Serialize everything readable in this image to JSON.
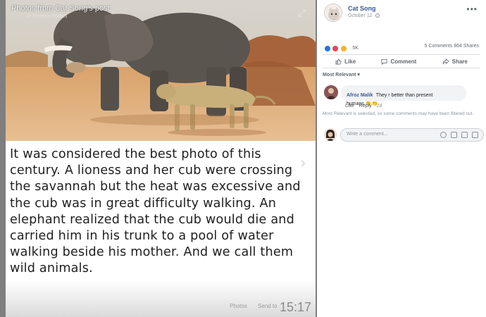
{
  "photo": {
    "caption": "Photos from Cat Song's post",
    "subcaption": "in Timeline Photos",
    "expand_icon": "expand-icon"
  },
  "story": {
    "text": "It was considered the best photo of this century. A lioness and her cub were crossing the savannah but the heat was excessive and the cub was in great difficulty walking. An elephant realized that the cub would die and carried him in his trunk to a pool of water walking beside his mother. And we call them wild animals.",
    "next_icon": "chevron-right-icon"
  },
  "phone_bar": {
    "meta_a": "Photos",
    "meta_b": "Send to",
    "time": "15:17"
  },
  "post": {
    "author": "Cat Song",
    "date": "October 12",
    "reaction_count": "5K",
    "comments": "5 Comments",
    "shares": "864 Shares",
    "actions": {
      "like": "Like",
      "comment": "Comment",
      "share": "Share"
    },
    "sort_label": "Most Relevant ▾",
    "colors": {
      "like": "#1877f2",
      "love": "#f33e58",
      "wow": "#f7b125",
      "link": "#385898"
    }
  },
  "comment": {
    "name": "Afroz Malik",
    "text": "They r better than present",
    "text2": "humans 👏👏",
    "like": "Like",
    "reply": "Reply",
    "time": "2d"
  },
  "notice": "Most Relevant is selected, so some comments may have been filtered out.",
  "composer": {
    "placeholder": "Write a comment..."
  }
}
